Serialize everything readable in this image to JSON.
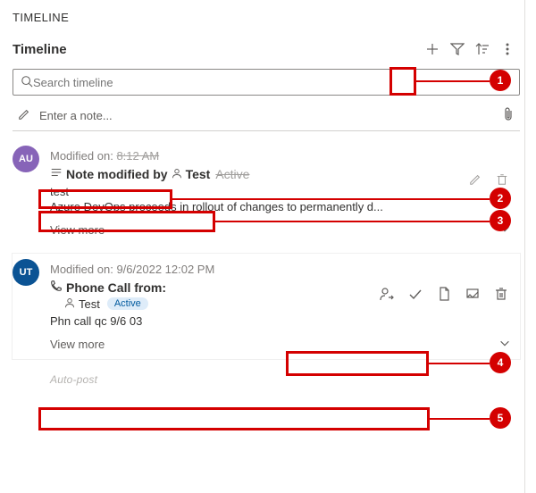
{
  "section_label": "TIMELINE",
  "header": {
    "title": "Timeline"
  },
  "search": {
    "placeholder": "Search timeline"
  },
  "note": {
    "placeholder": "Enter a note..."
  },
  "entries": [
    {
      "avatar": "AU",
      "modified_label": "Modified on:",
      "modified_time": "8:12 AM",
      "title_prefix": "Note modified by",
      "person": "Test",
      "status": "Active",
      "body": "test",
      "description": "Azure DevOps proceeds in rollout of changes to permanently d...",
      "view_more": "View more"
    },
    {
      "avatar": "UT",
      "modified_label": "Modified on:",
      "modified_time": "9/6/2022 12:02 PM",
      "title": "Phone Call from:",
      "person": "Test",
      "status": "Active",
      "body": "Phn call qc 9/6 03",
      "view_more": "View more"
    }
  ],
  "autopost": "Auto-post",
  "callouts": [
    "1",
    "2",
    "3",
    "4",
    "5"
  ]
}
